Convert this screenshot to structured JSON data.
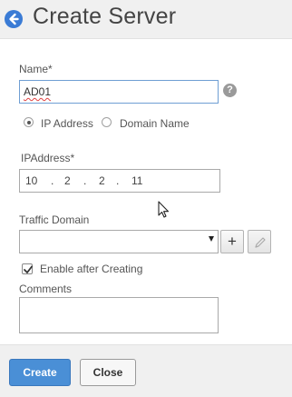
{
  "header": {
    "title": "Create Server",
    "back_icon": "arrow-left-circle-icon"
  },
  "form": {
    "name_label": "Name*",
    "name_value": "AD01",
    "help_glyph": "?",
    "radio_ip_label": "IP Address",
    "radio_domain_label": "Domain Name",
    "selected_type": "IP Address",
    "ip_label": "IPAddress*",
    "ip_octets": [
      "10",
      "2",
      "2",
      "11"
    ],
    "ip_dot": ".",
    "traffic_domain_label": "Traffic Domain",
    "traffic_domain_value": "",
    "add_glyph": "+",
    "enable_label": "Enable after Creating",
    "enable_checked": true,
    "comments_label": "Comments",
    "comments_value": ""
  },
  "footer": {
    "create_label": "Create",
    "close_label": "Close"
  },
  "colors": {
    "accent": "#3a7bd5",
    "create_button": "#4a8fd6",
    "background": "#f0f0f0"
  }
}
